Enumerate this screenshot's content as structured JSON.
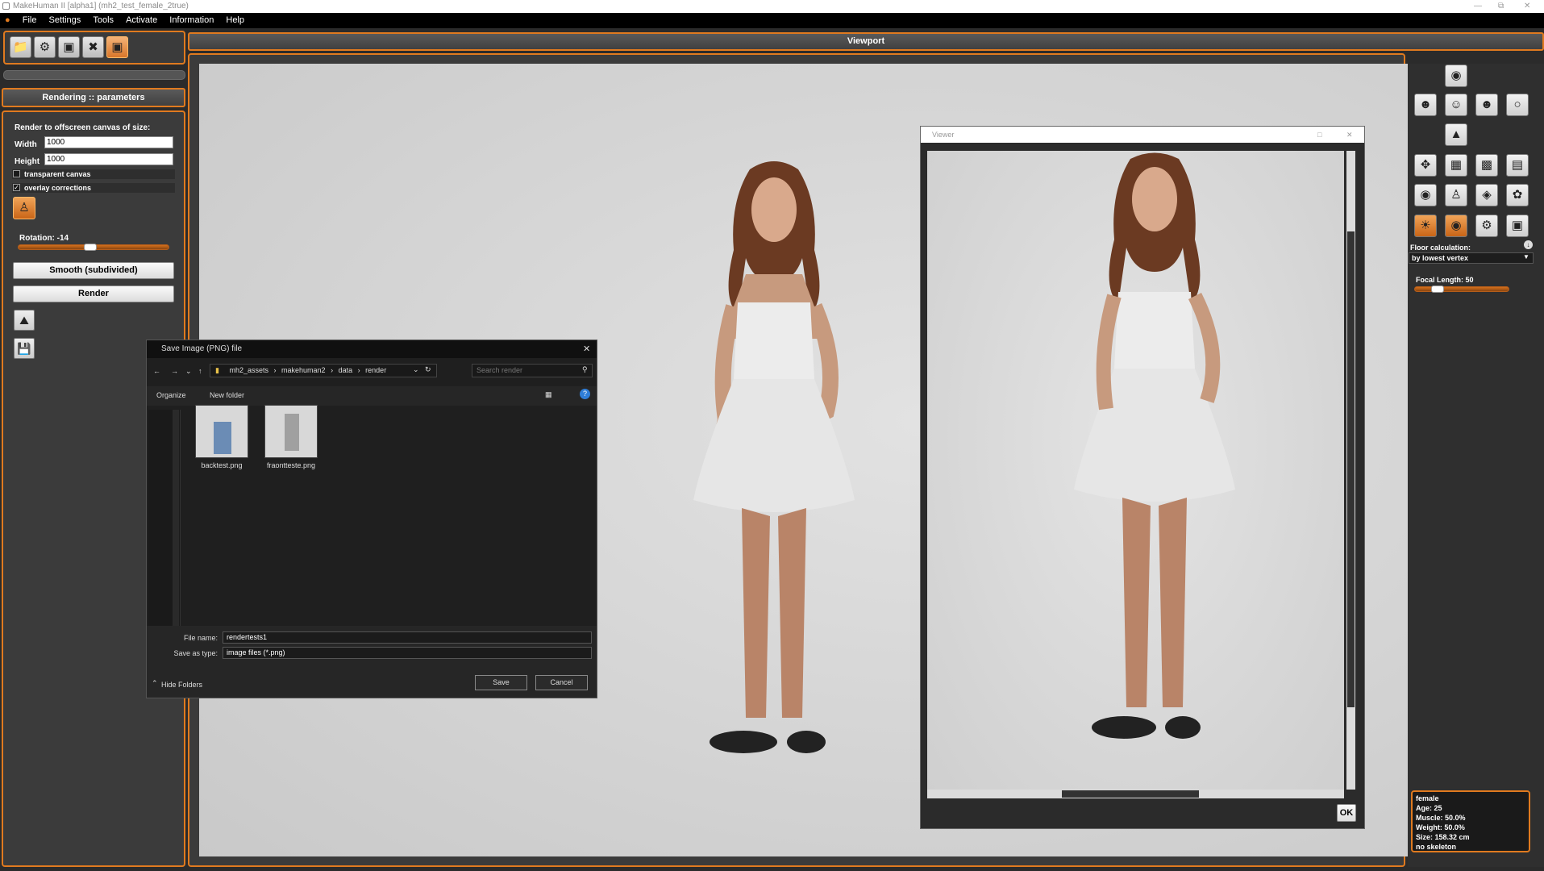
{
  "window": {
    "title": "MakeHuman II [alpha1]  (mh2_test_female_2true)"
  },
  "menu": [
    "File",
    "Settings",
    "Tools",
    "Activate",
    "Information",
    "Help"
  ],
  "toolbar": {
    "icons": [
      "folder-icon",
      "modify-icon",
      "clothes-icon",
      "pose-icon",
      "render-icon"
    ],
    "active_index": 4
  },
  "left": {
    "header": "Rendering :: parameters",
    "canvas_label": "Render to offscreen canvas of size:",
    "width_label": "Width",
    "width_value": "1000",
    "height_label": "Height",
    "height_value": "1000",
    "transparent_label": "transparent canvas",
    "transparent_checked": false,
    "overlay_label": "overlay corrections",
    "overlay_checked": true,
    "rotation_label": "Rotation: -14",
    "rotation_fraction": 0.47,
    "smooth_button": "Smooth (subdivided)",
    "render_button": "Render"
  },
  "viewport": {
    "title": "Viewport"
  },
  "dialog": {
    "title": "Save Image (PNG) file",
    "breadcrumb": [
      "mh2_assets",
      "makehuman2",
      "data",
      "render"
    ],
    "search_placeholder": "Search render",
    "organize": "Organize",
    "new_folder": "New folder",
    "files": [
      {
        "name": "backtest.png"
      },
      {
        "name": "fraontteste.png"
      }
    ],
    "file_name_label": "File name:",
    "file_name_value": "rendertests1",
    "save_type_label": "Save as type:",
    "save_type_value": "image files (*.png)",
    "hide_folders": "Hide Folders",
    "save_button": "Save",
    "cancel_button": "Cancel"
  },
  "viewer": {
    "title": "Viewer",
    "ok_button": "OK",
    "hscroll_fraction": 0.48
  },
  "right": {
    "floor_label": "Floor calculation:",
    "floor_value": "by lowest vertex",
    "focal_label": "Focal Length: 50",
    "focal_fraction": 0.2,
    "info": [
      "female",
      "Age: 25",
      "Muscle: 50.0%",
      "Weight: 50.0%",
      "Size: 158.32 cm",
      "no skeleton"
    ]
  },
  "colors": {
    "accent": "#e07a1f",
    "viewport_bg": "#d6d6d6"
  }
}
